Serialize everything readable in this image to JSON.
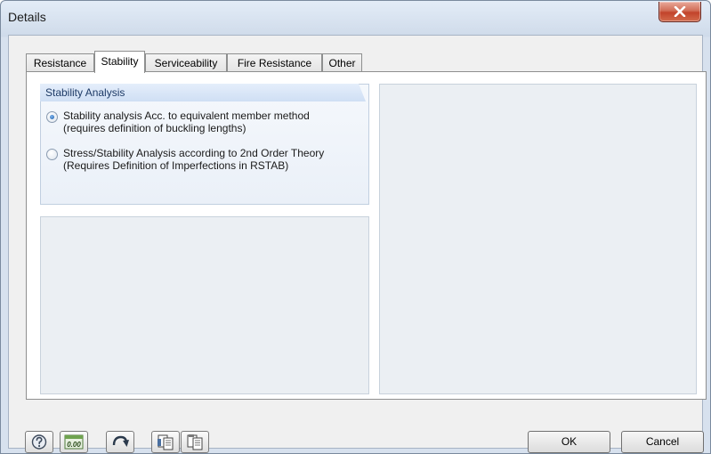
{
  "window": {
    "title": "Details"
  },
  "tabs": [
    {
      "label": "Resistance",
      "active": false
    },
    {
      "label": "Stability",
      "active": true
    },
    {
      "label": "Serviceability",
      "active": false
    },
    {
      "label": "Fire Resistance",
      "active": false
    },
    {
      "label": "Other",
      "active": false
    }
  ],
  "stability_analysis": {
    "header": "Stability Analysis",
    "options": [
      {
        "label": "Stability analysis Acc. to equivalent member method (requires definition of buckling lengths)",
        "checked": true
      },
      {
        "label": "Stress/Stability Analysis according to 2nd Order Theory (Requires Definition of Imperfections in RSTAB)",
        "checked": false
      }
    ]
  },
  "toolbar": {
    "decimal_label": "0.00",
    "icons": [
      "help-icon",
      "decimal-places-icon",
      "reset-arrow-icon",
      "copy-icon",
      "paste-icon"
    ]
  },
  "buttons": {
    "ok": "OK",
    "cancel": "Cancel"
  },
  "colors": {
    "accent": "#1d5ea8",
    "close_button": "#c2432b",
    "group_header_text": "#1d3a66"
  }
}
